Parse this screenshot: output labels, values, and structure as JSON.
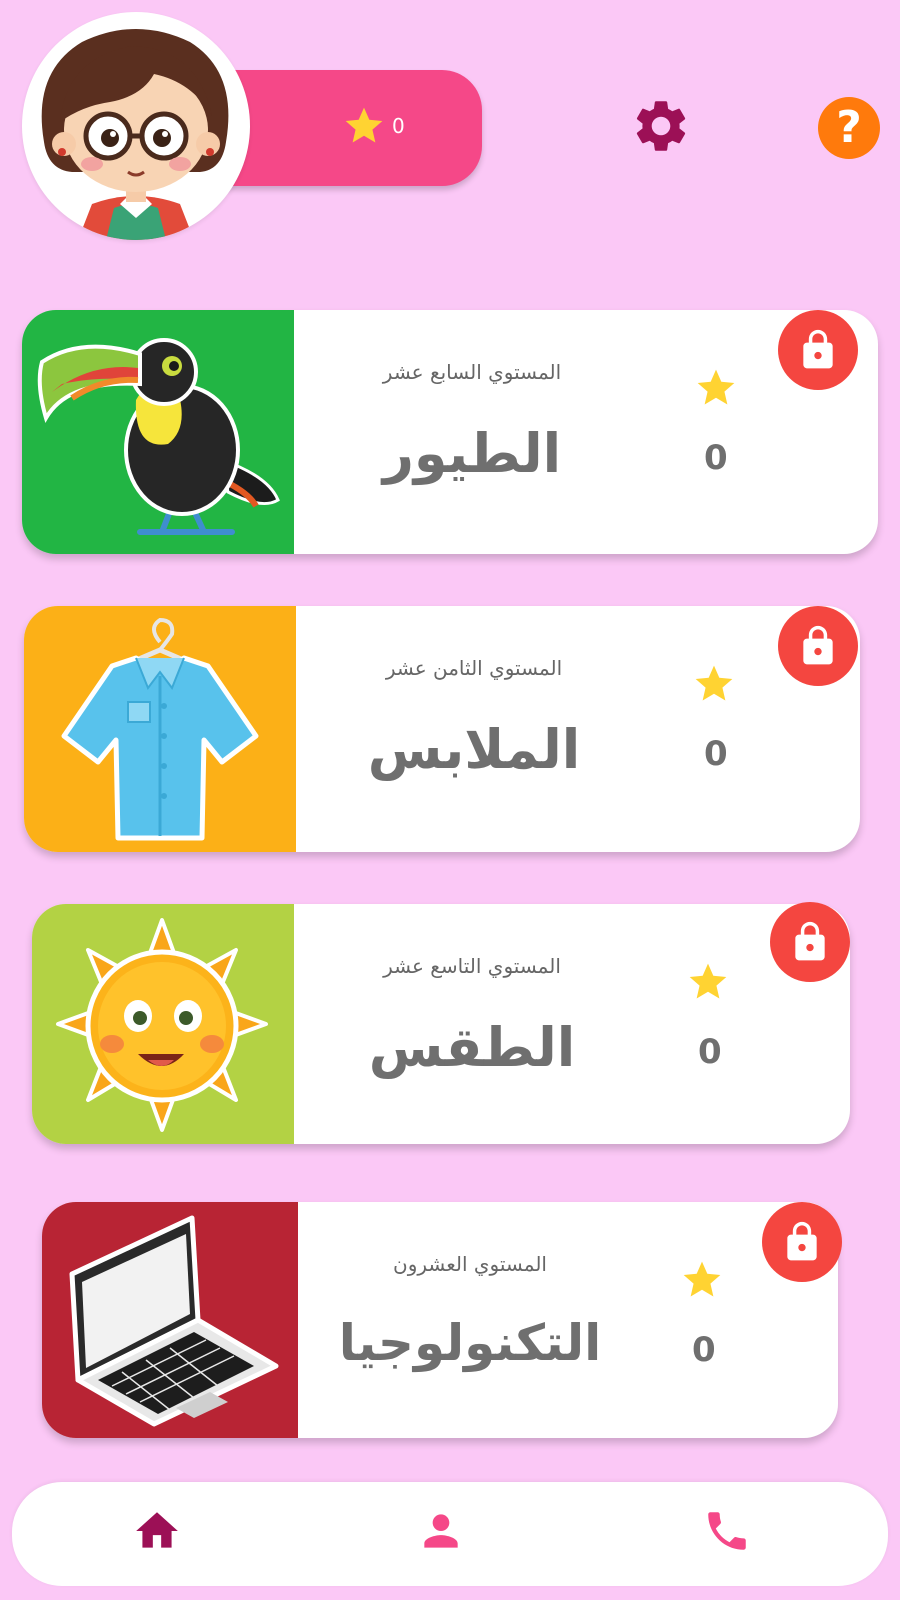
{
  "header": {
    "star_count": "0",
    "help_label": "?"
  },
  "levels": [
    {
      "level_label": "المستوي السابع عشر",
      "name": "الطيور",
      "stars": "0",
      "theme_color": "#22b544",
      "locked": true
    },
    {
      "level_label": "المستوي الثامن عشر",
      "name": "الملابس",
      "stars": "0",
      "theme_color": "#fcb017",
      "locked": true
    },
    {
      "level_label": "المستوي التاسع عشر",
      "name": "الطقس",
      "stars": "0",
      "theme_color": "#b3d244",
      "locked": true
    },
    {
      "level_label": "المستوي العشرون",
      "name": "التكنولوجيا",
      "stars": "0",
      "theme_color": "#b82434",
      "locked": true
    }
  ],
  "bottom_nav": {
    "items": [
      "home-icon",
      "profile-icon",
      "phone-icon"
    ],
    "active": "home-icon"
  },
  "colors": {
    "background": "#fbc8f6",
    "accent_pink": "#f54888",
    "settings": "#9c1056",
    "help": "#ff7a0c",
    "lock": "#f44640",
    "star": "#ffd332"
  }
}
